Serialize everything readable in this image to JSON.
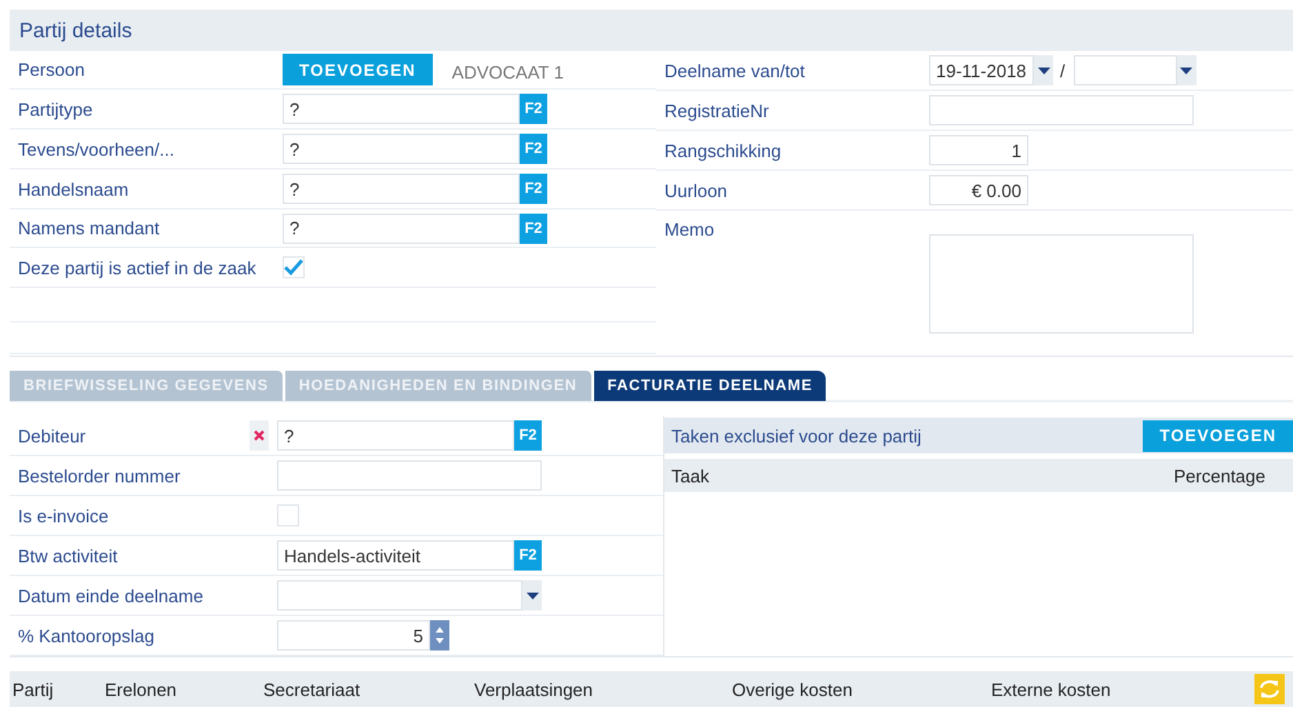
{
  "panel": {
    "title": "Partij details"
  },
  "left_fields": [
    {
      "kind": "person",
      "label": "Persoon",
      "button": "TOEVOEGEN",
      "value": "ADVOCAAT 1"
    },
    {
      "kind": "lookup",
      "label": "Partijtype",
      "value": "?",
      "key": "F2"
    },
    {
      "kind": "lookup",
      "label": "Tevens/voorheen/...",
      "value": "?",
      "key": "F2"
    },
    {
      "kind": "lookup",
      "label": "Handelsnaam",
      "value": "?",
      "key": "F2"
    },
    {
      "kind": "lookup",
      "label": "Namens mandant",
      "value": "?",
      "key": "F2"
    },
    {
      "kind": "checkbox",
      "label": "Deze partij is actief in de zaak",
      "checked": true
    }
  ],
  "right_fields": [
    {
      "kind": "daterange",
      "label": "Deelname van/tot",
      "from": "19-11-2018",
      "separator": "/"
    },
    {
      "kind": "text",
      "label": "RegistratieNr"
    },
    {
      "kind": "number",
      "label": "Rangschikking",
      "value": "1"
    },
    {
      "kind": "number",
      "label": "Uurloon",
      "value": "€ 0.00"
    },
    {
      "kind": "memo",
      "label": "Memo"
    }
  ],
  "tabs": [
    {
      "label": "BRIEFWISSELING GEGEVENS",
      "selected": false
    },
    {
      "label": "HOEDANIGHEDEN EN BINDINGEN",
      "selected": false
    },
    {
      "label": "FACTURATIE DEELNAME",
      "selected": true
    }
  ],
  "billing_fields": [
    {
      "kind": "lookup",
      "label": "Debiteur",
      "value": "?",
      "key": "F2",
      "clearable": true
    },
    {
      "kind": "text",
      "label": "Bestelorder nummer"
    },
    {
      "kind": "checkbox",
      "label": "Is e-invoice",
      "checked": false
    },
    {
      "kind": "lookup",
      "label": "Btw activiteit",
      "value": "Handels-activiteit",
      "key": "F2"
    },
    {
      "kind": "date",
      "label": "Datum einde deelname"
    },
    {
      "kind": "spinner",
      "label": "% Kantooropslag",
      "value": "5"
    }
  ],
  "tasks": {
    "title": "Taken exclusief voor deze partij",
    "button": "TOEVOEGEN",
    "columns": [
      "Taak",
      "Percentage"
    ]
  },
  "cost_table": {
    "columns": [
      "Partij",
      "Erelonen",
      "Secretariaat",
      "Verplaatsingen",
      "Overige kosten",
      "Externe kosten"
    ]
  }
}
